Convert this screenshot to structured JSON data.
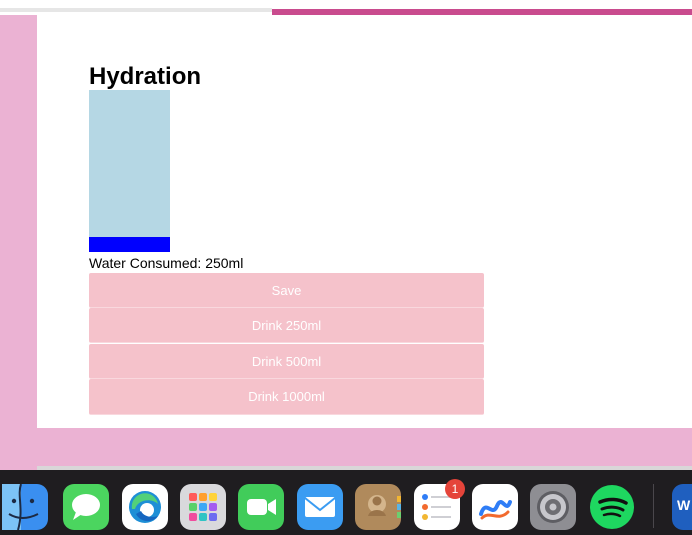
{
  "app": {
    "title": "Hydration",
    "consumed_label": "Water Consumed: ",
    "consumed_value": "250ml",
    "fill_fraction": 0.09
  },
  "buttons": {
    "save": "Save",
    "drink_250": "Drink 250ml",
    "drink_500": "Drink 500ml",
    "drink_1000": "Drink 1000ml"
  },
  "colors": {
    "background_pink": "#ebb2d3",
    "button_pink": "#f5c2cb",
    "bottle_light_blue": "#b5d7e4",
    "bottle_fill_blue": "#0000ff",
    "accent_magenta": "#c94b8e"
  },
  "dock": {
    "apps": [
      "finder-icon",
      "messages-icon",
      "edge-icon",
      "launchpad-icon",
      "facetime-icon",
      "mail-icon",
      "contacts-icon",
      "reminders-icon",
      "freeform-icon",
      "system-settings-icon",
      "spotify-icon",
      "word-icon"
    ],
    "reminders_badge": "1",
    "word_letter": "W"
  }
}
